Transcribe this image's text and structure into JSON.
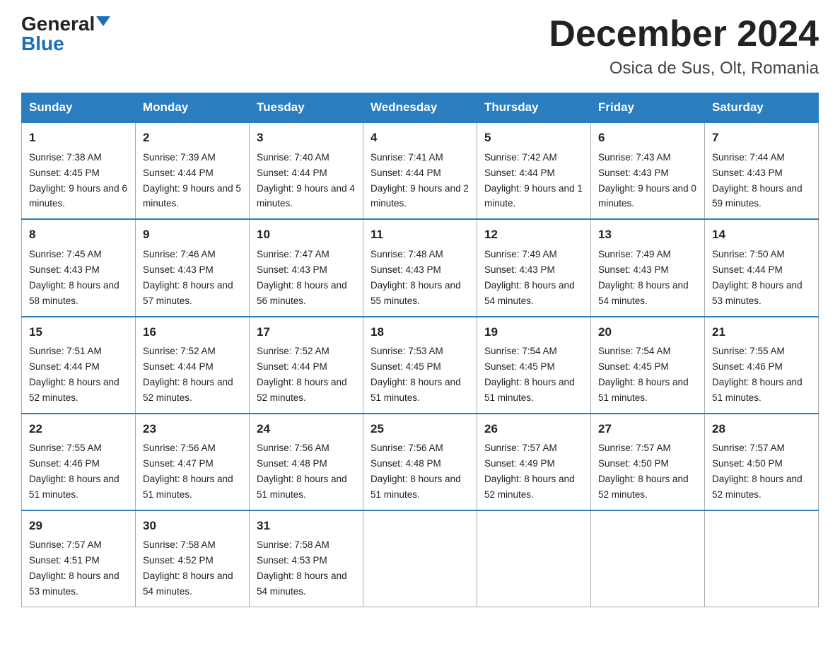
{
  "header": {
    "logo_general": "General",
    "logo_blue": "Blue",
    "month_title": "December 2024",
    "location": "Osica de Sus, Olt, Romania"
  },
  "days_of_week": [
    "Sunday",
    "Monday",
    "Tuesday",
    "Wednesday",
    "Thursday",
    "Friday",
    "Saturday"
  ],
  "weeks": [
    [
      {
        "day": 1,
        "sunrise": "7:38 AM",
        "sunset": "4:45 PM",
        "daylight": "9 hours and 6 minutes."
      },
      {
        "day": 2,
        "sunrise": "7:39 AM",
        "sunset": "4:44 PM",
        "daylight": "9 hours and 5 minutes."
      },
      {
        "day": 3,
        "sunrise": "7:40 AM",
        "sunset": "4:44 PM",
        "daylight": "9 hours and 4 minutes."
      },
      {
        "day": 4,
        "sunrise": "7:41 AM",
        "sunset": "4:44 PM",
        "daylight": "9 hours and 2 minutes."
      },
      {
        "day": 5,
        "sunrise": "7:42 AM",
        "sunset": "4:44 PM",
        "daylight": "9 hours and 1 minute."
      },
      {
        "day": 6,
        "sunrise": "7:43 AM",
        "sunset": "4:43 PM",
        "daylight": "9 hours and 0 minutes."
      },
      {
        "day": 7,
        "sunrise": "7:44 AM",
        "sunset": "4:43 PM",
        "daylight": "8 hours and 59 minutes."
      }
    ],
    [
      {
        "day": 8,
        "sunrise": "7:45 AM",
        "sunset": "4:43 PM",
        "daylight": "8 hours and 58 minutes."
      },
      {
        "day": 9,
        "sunrise": "7:46 AM",
        "sunset": "4:43 PM",
        "daylight": "8 hours and 57 minutes."
      },
      {
        "day": 10,
        "sunrise": "7:47 AM",
        "sunset": "4:43 PM",
        "daylight": "8 hours and 56 minutes."
      },
      {
        "day": 11,
        "sunrise": "7:48 AM",
        "sunset": "4:43 PM",
        "daylight": "8 hours and 55 minutes."
      },
      {
        "day": 12,
        "sunrise": "7:49 AM",
        "sunset": "4:43 PM",
        "daylight": "8 hours and 54 minutes."
      },
      {
        "day": 13,
        "sunrise": "7:49 AM",
        "sunset": "4:43 PM",
        "daylight": "8 hours and 54 minutes."
      },
      {
        "day": 14,
        "sunrise": "7:50 AM",
        "sunset": "4:44 PM",
        "daylight": "8 hours and 53 minutes."
      }
    ],
    [
      {
        "day": 15,
        "sunrise": "7:51 AM",
        "sunset": "4:44 PM",
        "daylight": "8 hours and 52 minutes."
      },
      {
        "day": 16,
        "sunrise": "7:52 AM",
        "sunset": "4:44 PM",
        "daylight": "8 hours and 52 minutes."
      },
      {
        "day": 17,
        "sunrise": "7:52 AM",
        "sunset": "4:44 PM",
        "daylight": "8 hours and 52 minutes."
      },
      {
        "day": 18,
        "sunrise": "7:53 AM",
        "sunset": "4:45 PM",
        "daylight": "8 hours and 51 minutes."
      },
      {
        "day": 19,
        "sunrise": "7:54 AM",
        "sunset": "4:45 PM",
        "daylight": "8 hours and 51 minutes."
      },
      {
        "day": 20,
        "sunrise": "7:54 AM",
        "sunset": "4:45 PM",
        "daylight": "8 hours and 51 minutes."
      },
      {
        "day": 21,
        "sunrise": "7:55 AM",
        "sunset": "4:46 PM",
        "daylight": "8 hours and 51 minutes."
      }
    ],
    [
      {
        "day": 22,
        "sunrise": "7:55 AM",
        "sunset": "4:46 PM",
        "daylight": "8 hours and 51 minutes."
      },
      {
        "day": 23,
        "sunrise": "7:56 AM",
        "sunset": "4:47 PM",
        "daylight": "8 hours and 51 minutes."
      },
      {
        "day": 24,
        "sunrise": "7:56 AM",
        "sunset": "4:48 PM",
        "daylight": "8 hours and 51 minutes."
      },
      {
        "day": 25,
        "sunrise": "7:56 AM",
        "sunset": "4:48 PM",
        "daylight": "8 hours and 51 minutes."
      },
      {
        "day": 26,
        "sunrise": "7:57 AM",
        "sunset": "4:49 PM",
        "daylight": "8 hours and 52 minutes."
      },
      {
        "day": 27,
        "sunrise": "7:57 AM",
        "sunset": "4:50 PM",
        "daylight": "8 hours and 52 minutes."
      },
      {
        "day": 28,
        "sunrise": "7:57 AM",
        "sunset": "4:50 PM",
        "daylight": "8 hours and 52 minutes."
      }
    ],
    [
      {
        "day": 29,
        "sunrise": "7:57 AM",
        "sunset": "4:51 PM",
        "daylight": "8 hours and 53 minutes."
      },
      {
        "day": 30,
        "sunrise": "7:58 AM",
        "sunset": "4:52 PM",
        "daylight": "8 hours and 54 minutes."
      },
      {
        "day": 31,
        "sunrise": "7:58 AM",
        "sunset": "4:53 PM",
        "daylight": "8 hours and 54 minutes."
      },
      null,
      null,
      null,
      null
    ]
  ]
}
